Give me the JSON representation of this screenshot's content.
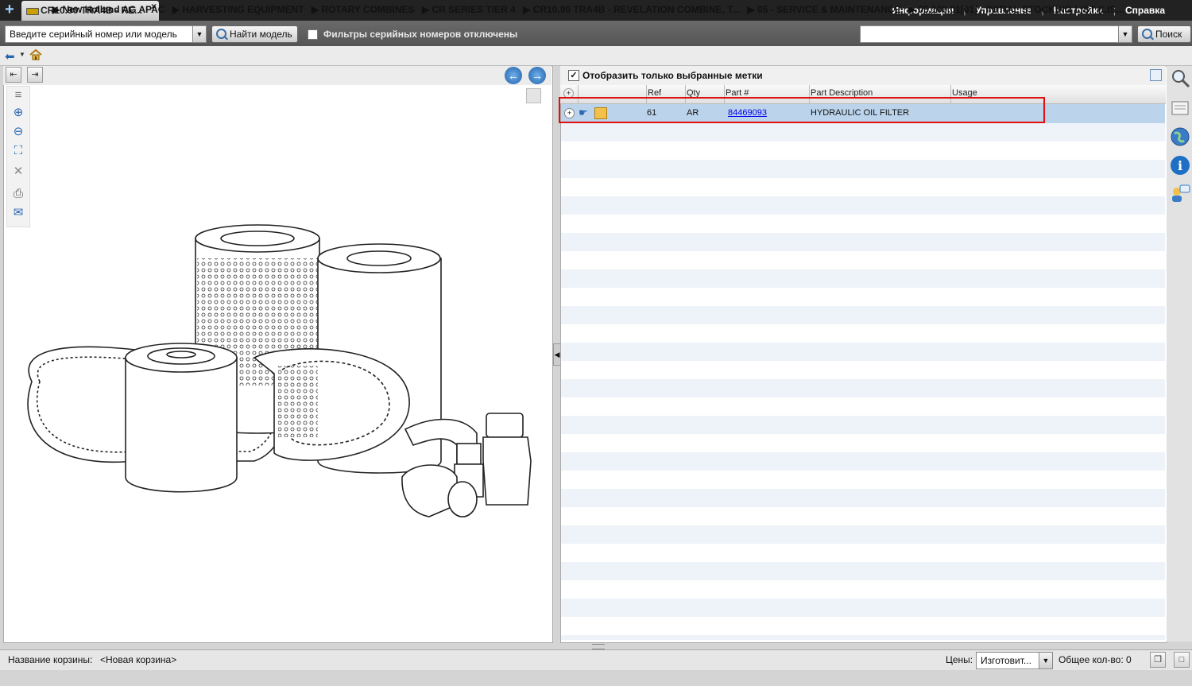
{
  "tab": {
    "title": "CR10.90 TRA4B - RE...",
    "close": "×",
    "add": "+"
  },
  "top_menu": [
    "Информация",
    "Управление",
    "Настройки",
    "Справка"
  ],
  "search": {
    "serial_value": "Введите серийный номер или модель",
    "find_model": "Найти модель",
    "serial_filter_label": "Фильтры серийных номеров отключены",
    "search_input_value": "",
    "search_button": "Поиск"
  },
  "breadcrumb": [
    "▶ New Holland AG APAC",
    "▶ HARVESTING EQUIPMENT",
    "▶ ROTARY COMBINES",
    "▶ CR SERIES TIER 4",
    "▶ CR10.90 TRA4B - REVELATION COMBINE, T...",
    "▶ 05 - SERVICE & MAINTENANCE",
    "▶ 05.100.01[01] - INITIAL STOCKING LIST (LIS..."
  ],
  "parts_panel": {
    "only_selected_label": "Отобразить только выбранные метки",
    "only_selected_checked": true,
    "columns": [
      "Ref",
      "Qty",
      "Part #",
      "Part Description",
      "Usage"
    ],
    "rows": [
      {
        "ref": "61",
        "qty": "AR",
        "part": "84469093",
        "description": "HYDRAULIC OIL FILTER",
        "usage": ""
      }
    ]
  },
  "bottom": {
    "basket_label": "Название корзины:",
    "basket_value": "<Новая корзина>",
    "prices_label": "Цены:",
    "prices_value": "Изготовит...",
    "total_label": "Общее кол-во: 0"
  },
  "colors": {
    "highlight": "#e01010",
    "selected_row": "#bcd4eb",
    "topbar": "#222222",
    "link": "#0000ee"
  }
}
